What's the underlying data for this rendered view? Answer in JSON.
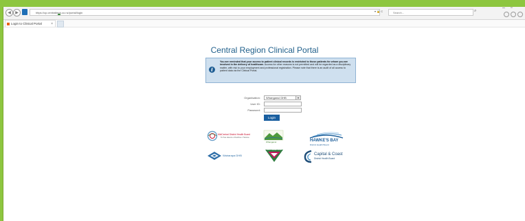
{
  "browser": {
    "url": "https://cp.centraltech.co.nz/portal/login",
    "search_placeholder": "Search...",
    "tab_title": "Login to Clinical Portal",
    "addr_tools": "▾ 🔒 C"
  },
  "page": {
    "title": "Central Region Clinical Portal",
    "notice_bold": "You are reminded that your access to patient clinical records is restricted to those patients for whom you are involved in the delivery of healthcare.",
    "notice_rest": " Access for other reasons is not permitted and will be regarded as a disciplinary matter, with risk to your employment and professional registration. Please note that there is an audit of all access to patient data via the Clinical Portal."
  },
  "form": {
    "organisation_label": "Organisation:",
    "organisation_value": "Whanganui DHB",
    "userid_label": "User ID:",
    "password_label": "Password:",
    "login_label": "Login"
  },
  "logos": {
    "midcentral_name": "MidCentral District Health Board",
    "midcentral_tagline": "Te Pae Hauora o Ruahine o Tararua",
    "whanganui_name": "Whanganui",
    "hawkesbay_name": "HAWKE'S BAY",
    "hawkesbay_sub": "District Health Board",
    "wairarapa_name": "Wairarapa DHB",
    "hutt_name": "HUTT VALLEY DHB",
    "capital_name": "Capital & Coast",
    "capital_sub": "District Health Board"
  },
  "colors": {
    "frame": "#8dc63f",
    "title": "#22618c",
    "notice_bg": "#cfe0ef",
    "button": "#1a5fa0"
  },
  "icons": [
    "back-icon",
    "forward-icon",
    "lock-icon",
    "search-icon",
    "info-icon",
    "close-icon"
  ]
}
